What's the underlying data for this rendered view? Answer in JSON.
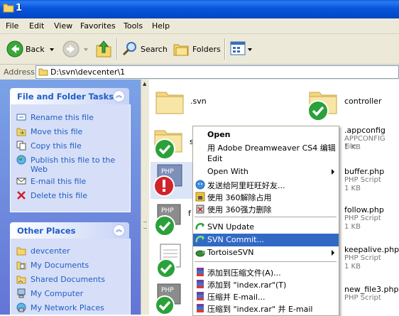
{
  "window": {
    "title": "1"
  },
  "menu": [
    "File",
    "Edit",
    "View",
    "Favorites",
    "Tools",
    "Help"
  ],
  "toolbar": {
    "back": "Back",
    "search": "Search",
    "folders": "Folders"
  },
  "address": {
    "label": "Address",
    "path": "D:\\svn\\devcenter\\1"
  },
  "tasks_panel": {
    "title": "File and Folder Tasks",
    "items": [
      "Rename this file",
      "Move this file",
      "Copy this file",
      "Publish this file to the",
      "Web",
      "E-mail this file",
      "Delete this file"
    ]
  },
  "places_panel": {
    "title": "Other Places",
    "items": [
      "devcenter",
      "My Documents",
      "Shared Documents",
      "My Computer",
      "My Network Places"
    ]
  },
  "files": [
    {
      "name": ".svn",
      "type": "",
      "size": ""
    },
    {
      "name": "controller",
      "type": "",
      "size": ""
    },
    {
      "name": ".appconfig",
      "type": "APPCONFIG File",
      "size": "1 KB"
    },
    {
      "name": "buffer.php",
      "type": "PHP Script",
      "size": "1 KB"
    },
    {
      "name": "follow.php",
      "type": "PHP Script",
      "size": "1 KB"
    },
    {
      "name": "keepalive.php",
      "type": "PHP Script",
      "size": "1 KB"
    },
    {
      "name": "new_file3.php",
      "type": "PHP Script",
      "size": ""
    }
  ],
  "file_partial_labels": {
    "left_s": "s",
    "left_f": "f"
  },
  "context_menu": {
    "items": [
      "Open",
      "用 Adobe Dreamweaver CS4 编辑",
      "Edit",
      "Open With",
      "发送给阿里旺旺好友...",
      "使用 360解除占用",
      "使用 360强力删除",
      "SVN Update",
      "SVN Commit...",
      "TortoiseSVN",
      "添加到压缩文件(A)...",
      "添加到 \"index.rar\"(T)",
      "压缩并 E-mail...",
      "压缩到 \"index.rar\" 并 E-mail"
    ]
  },
  "colors": {
    "titlebar": "#0a5ee0",
    "selection": "#316ac5",
    "task_text": "#215dc6"
  }
}
